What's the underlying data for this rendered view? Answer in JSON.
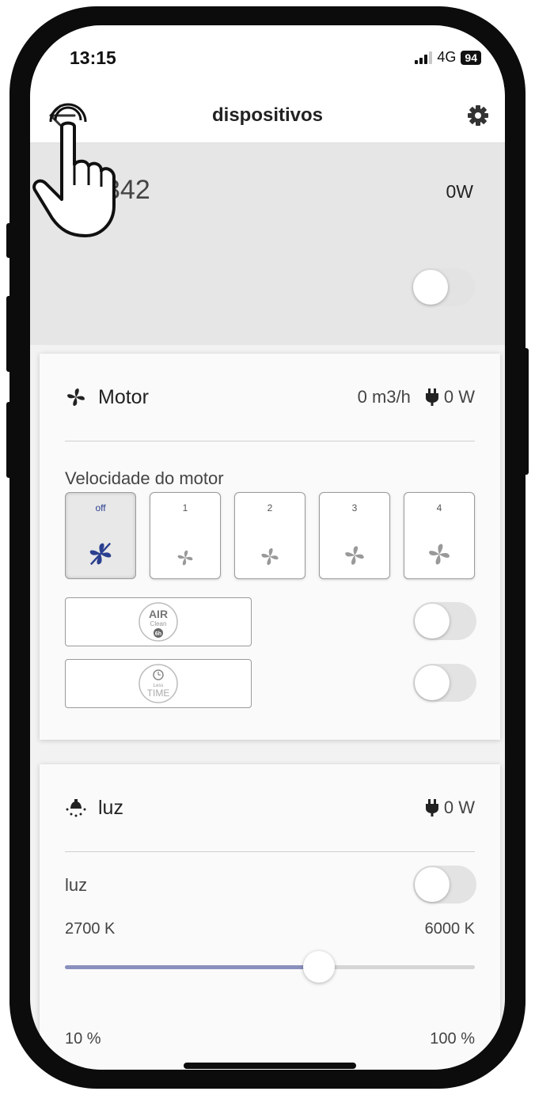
{
  "status_bar": {
    "time": "13:15",
    "network": "4G",
    "battery": "94"
  },
  "header": {
    "title": "dispositivos",
    "back_icon": "back-arrow-icon",
    "settings_icon": "gear-icon"
  },
  "device": {
    "id_partial": "342",
    "power": "0W",
    "toggle_on": false
  },
  "motor": {
    "title": "Motor",
    "airflow": "0 m3/h",
    "power": "0 W",
    "speed_label": "Velocidade do motor",
    "speeds": [
      {
        "label": "off",
        "active": true
      },
      {
        "label": "1",
        "active": false
      },
      {
        "label": "2",
        "active": false
      },
      {
        "label": "3",
        "active": false
      },
      {
        "label": "4",
        "active": false
      }
    ],
    "options": [
      {
        "badge_line1": "AIR",
        "badge_line2": "Clean",
        "badge_line3": "6h",
        "toggle_on": false
      },
      {
        "badge_line1": "Less",
        "badge_line2": "TIME",
        "toggle_on": false
      }
    ]
  },
  "luz": {
    "title": "luz",
    "power": "0 W",
    "toggle_label": "luz",
    "toggle_on": false,
    "temp_min": "2700 K",
    "temp_max": "6000 K",
    "temp_slider_fraction": 0.62,
    "brightness_min": "10 %",
    "brightness_max": "100 %"
  },
  "colors": {
    "accent": "#2a3f8f",
    "slider_fill": "#8a90bd",
    "header_bg": "#e6e6e6"
  }
}
